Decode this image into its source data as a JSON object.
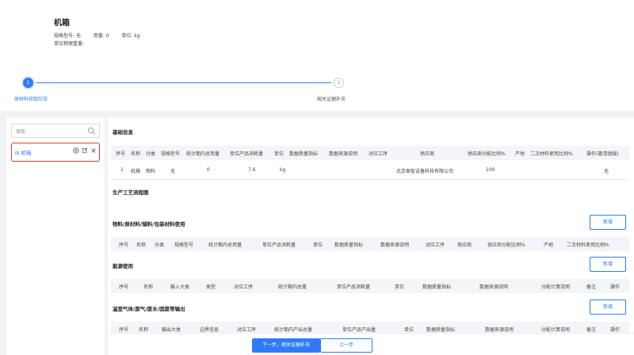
{
  "header": {
    "title": "机箱",
    "spec_label": "规格型号:",
    "spec_value": "无",
    "qty_label": "用量:",
    "qty_value": "0",
    "unit_label": "单位:",
    "unit_value": "kg",
    "weight_label": "单位物理重量:"
  },
  "steps": [
    {
      "num": "1",
      "label": "原材料获取阶段"
    },
    {
      "num": "2",
      "label": "相关证据补充"
    }
  ],
  "sidebar": {
    "search_placeholder": "搜索",
    "tree_item": "机箱",
    "tree_toggle": "⊟"
  },
  "basic_info": {
    "title": "基础信息",
    "columns": [
      "序号",
      "名称",
      "分类",
      "规格型号",
      "统计期内总用量",
      "单位产品消耗量",
      "单位",
      "数据质量指标",
      "数据来源说明",
      "对应工序",
      "供应商",
      "供应商分配比例%",
      "产地",
      "二次材料使用比例%",
      "操作(邀请填报)"
    ],
    "row": {
      "seq": "1",
      "name": "机箱",
      "category": "物料",
      "spec": "无",
      "total": "0",
      "per_unit": "7.6",
      "unit": "kg",
      "supplier": "北京泰智设备科技有限公司",
      "ratio": "100",
      "op": "无"
    }
  },
  "process_flow": {
    "title": "生产工艺流程图"
  },
  "materials": {
    "title": "物料/原材料/辅料/包装材料使用",
    "add_label": "新增",
    "columns": [
      "序号",
      "名称",
      "分类",
      "规格型号",
      "统计期内总用量",
      "单位产品消耗量",
      "单位",
      "数据质量指标",
      "数据来源说明",
      "对应工序",
      "供应商",
      "供应商分配比例%",
      "产地",
      "二次材料使用比例%"
    ]
  },
  "energy": {
    "title": "能源使用",
    "add_label": "新增",
    "columns": [
      "序号",
      "名称",
      "输入大类",
      "类型",
      "对应工序",
      "统计期内总量",
      "单位产品消耗量",
      "单位",
      "数据质量指标",
      "数据来源说明",
      "分配计算说明",
      "备注",
      "操作"
    ]
  },
  "emissions": {
    "title": "温室气体/废气/废水/固废等输出",
    "add_label": "新增",
    "columns": [
      "序号",
      "名称",
      "输出大类",
      "边界信息",
      "对应工序",
      "统计期内产出总量",
      "单位产品产出量",
      "单位",
      "数据质量指标",
      "数据来源说明",
      "分配计算说明",
      "备注",
      "操作"
    ]
  },
  "footer": {
    "next_label": "下一步，相关证据补充",
    "prev_label": "上一步"
  },
  "colors": {
    "accent": "#2f7bf5",
    "highlight_border": "#e53935"
  }
}
